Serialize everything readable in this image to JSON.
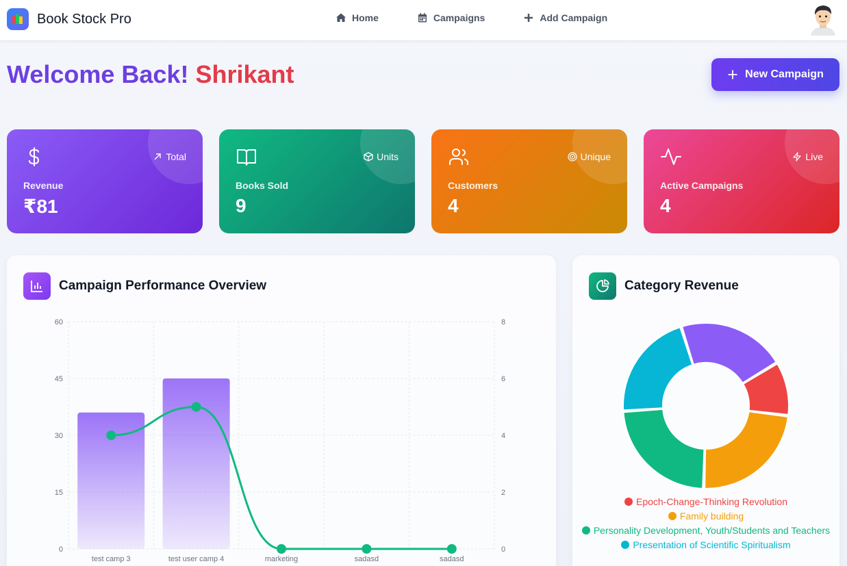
{
  "app": {
    "name": "Book Stock Pro"
  },
  "nav": {
    "home": "Home",
    "campaigns": "Campaigns",
    "add_campaign": "Add Campaign"
  },
  "welcome": {
    "greeting": "Welcome Back!",
    "user": "Shrikant"
  },
  "actions": {
    "new_campaign": "New Campaign"
  },
  "stats": {
    "revenue": {
      "tag": "Total",
      "label": "Revenue",
      "value": "₹81",
      "icon": "dollar-icon"
    },
    "books_sold": {
      "tag": "Units",
      "label": "Books Sold",
      "value": "9",
      "icon": "book-open-icon"
    },
    "customers": {
      "tag": "Unique",
      "label": "Customers",
      "value": "4",
      "icon": "users-icon"
    },
    "active_campaigns": {
      "tag": "Live",
      "label": "Active Campaigns",
      "value": "4",
      "icon": "activity-icon"
    }
  },
  "performance": {
    "title": "Campaign Performance Overview"
  },
  "category": {
    "title": "Category Revenue"
  },
  "chart_data": [
    {
      "type": "bar",
      "categories": [
        "test camp 3",
        "test user camp 4",
        "marketing",
        "sadasd",
        "sadasd"
      ],
      "series": [
        {
          "type": "bar",
          "values": [
            36,
            45,
            0,
            0,
            0
          ],
          "axis": "left",
          "color": "#8b5cf6"
        },
        {
          "type": "line",
          "values": [
            4,
            5,
            0,
            0,
            0
          ],
          "axis": "right",
          "color": "#10b981"
        }
      ],
      "y_left": {
        "ticks": [
          0,
          15,
          30,
          45,
          60
        ],
        "range": [
          0,
          60
        ]
      },
      "y_right": {
        "ticks": [
          0,
          2,
          4,
          6,
          8
        ],
        "range": [
          0,
          8
        ]
      },
      "grid": true
    },
    {
      "type": "pie",
      "donut": true,
      "slices": [
        {
          "label": "Epoch-Change-Thinking Revolution",
          "value": 9,
          "color": "#ef4444"
        },
        {
          "label": "Family building",
          "value": 20,
          "color": "#f59e0b"
        },
        {
          "label": "Personality Development, Youth/Students and Teachers",
          "value": 20,
          "color": "#10b981"
        },
        {
          "label": "Presentation of Scientific Spiritualism",
          "value": 18,
          "color": "#06b6d4"
        },
        {
          "label": "",
          "value": 18,
          "color": "#8b5cf6"
        }
      ],
      "legend": [
        "Epoch-Change-Thinking Revolution",
        "Family building",
        "Personality Development, Youth/Students and Teachers",
        "Presentation of Scientific Spiritualism"
      ],
      "legend_placement": "bottom"
    }
  ],
  "colors": {
    "accent": "#6d3fe0",
    "user_name": "#e23b4a"
  }
}
